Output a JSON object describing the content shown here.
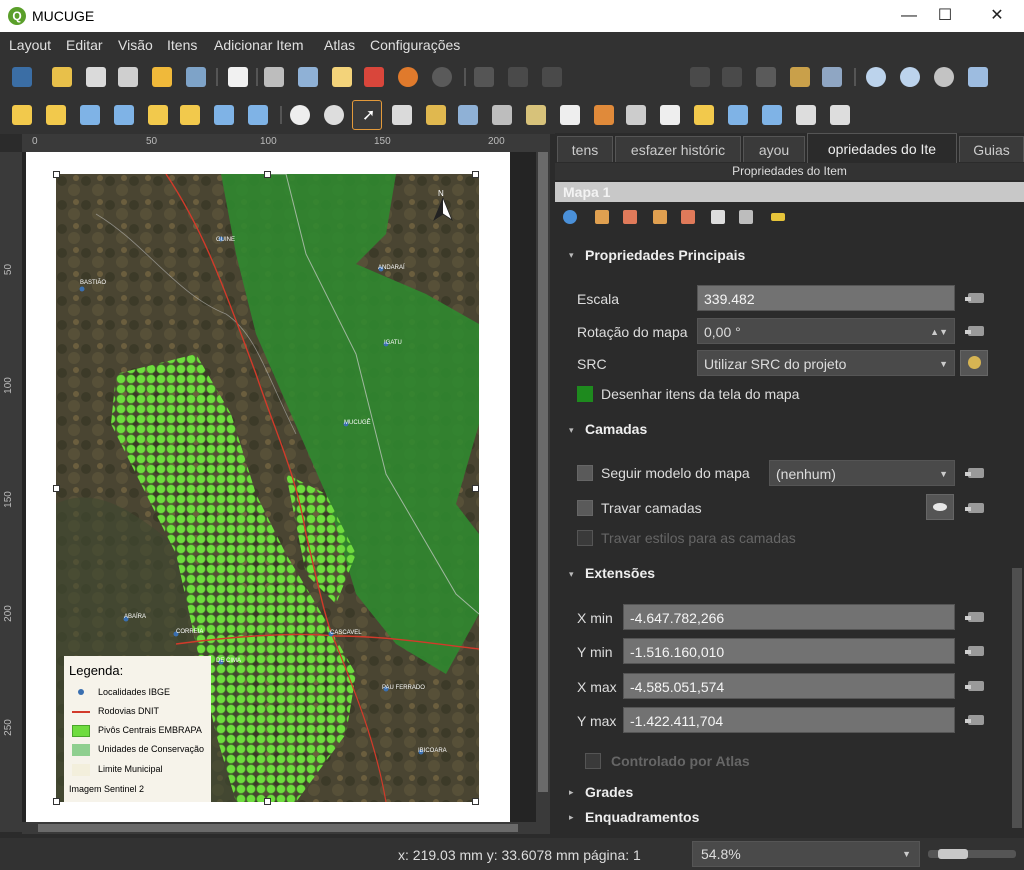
{
  "window": {
    "title": "MUCUGE",
    "minimize": "—",
    "maximize": "☐",
    "close": "✕"
  },
  "menu": [
    "Layout",
    "Editar",
    "Visão",
    "Itens",
    "Adicionar Item",
    "Atlas",
    "Configurações"
  ],
  "toolbar": {
    "page_number": "1"
  },
  "rulers": {
    "horizontal": [
      "0",
      "50",
      "100",
      "150",
      "200"
    ],
    "vertical": [
      "50",
      "100",
      "150",
      "200",
      "250"
    ]
  },
  "map": {
    "north_arrow": "N",
    "places": [
      "GUINE",
      "ANDARAÍ",
      "BASTIÃO",
      "IGATU",
      "MUCUGÊ",
      "ABAÍRA",
      "JUSSIAPE",
      "CASCAVEL",
      "PAU FERRADO",
      "IBICOARA",
      "CORREIA",
      "DE CIMA"
    ]
  },
  "legend": {
    "title": "Legenda:",
    "items": [
      {
        "label": "Localidades IBGE",
        "color": "#3a6fb0"
      },
      {
        "label": "Rodovias DNIT",
        "color": "#d23a2a"
      },
      {
        "label": "Pivôs Centrais EMBRAPA",
        "color": "#6fdc3e"
      },
      {
        "label": "Unidades de Conservação",
        "color": "#8fcf8f"
      },
      {
        "label": "Limite Municipal",
        "color": "#f3efdc"
      }
    ],
    "footer": "Imagem Sentinel 2"
  },
  "panel": {
    "tabs": [
      "tens",
      "esfazer históric",
      "ayou",
      "opriedades do Ite",
      "Guias"
    ],
    "header": "Propriedades do Item",
    "item_name": "Mapa 1",
    "sections": {
      "main": "Propriedades Principais",
      "layers": "Camadas",
      "extents": "Extensões",
      "grids": "Grades",
      "frames": "Enquadramentos"
    },
    "main": {
      "scale_label": "Escala",
      "scale_value": "339.482",
      "rotation_label": "Rotação do mapa",
      "rotation_value": "0,00 °",
      "crs_label": "SRC",
      "crs_value": "Utilizar SRC do projeto",
      "draw_items_label": "Desenhar itens da tela do mapa"
    },
    "layers": {
      "follow_theme_label": "Seguir modelo do mapa",
      "follow_theme_value": "(nenhum)",
      "lock_layers_label": "Travar camadas",
      "lock_styles_label": "Travar estilos para as camadas"
    },
    "extents": {
      "xmin_label": "X min",
      "xmin_value": "-4.647.782,266",
      "ymin_label": "Y min",
      "ymin_value": "-1.516.160,010",
      "xmax_label": "X max",
      "xmax_value": "-4.585.051,574",
      "ymax_label": "Y max",
      "ymax_value": "-1.422.411,704",
      "atlas_label": "Controlado por Atlas"
    }
  },
  "status": {
    "coords": "x: 219.03 mm y: 33.6078 mm página: 1",
    "zoom": "54.8%",
    "zoom_slider_fraction": 0.28
  }
}
